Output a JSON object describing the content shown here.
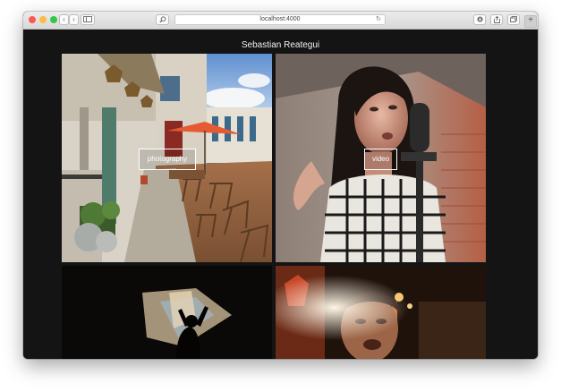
{
  "browser": {
    "url": "localhost:4000",
    "icons": {
      "back": "chevron-left-icon",
      "forward": "chevron-right-icon",
      "sidebar": "sidebar-icon",
      "search": "magnifier-icon",
      "reload": "reload-icon",
      "downloads": "download-icon",
      "share": "share-icon",
      "tabs": "tabs-icon",
      "new_tab": "plus-icon"
    },
    "colors": {
      "close": "#fc5753",
      "minimize": "#fdbc40",
      "zoom": "#33c748"
    }
  },
  "site": {
    "title": "Sebastian Reategui",
    "tiles": [
      {
        "label": "photography"
      },
      {
        "label": "video"
      },
      {
        "label": ""
      },
      {
        "label": ""
      }
    ]
  }
}
